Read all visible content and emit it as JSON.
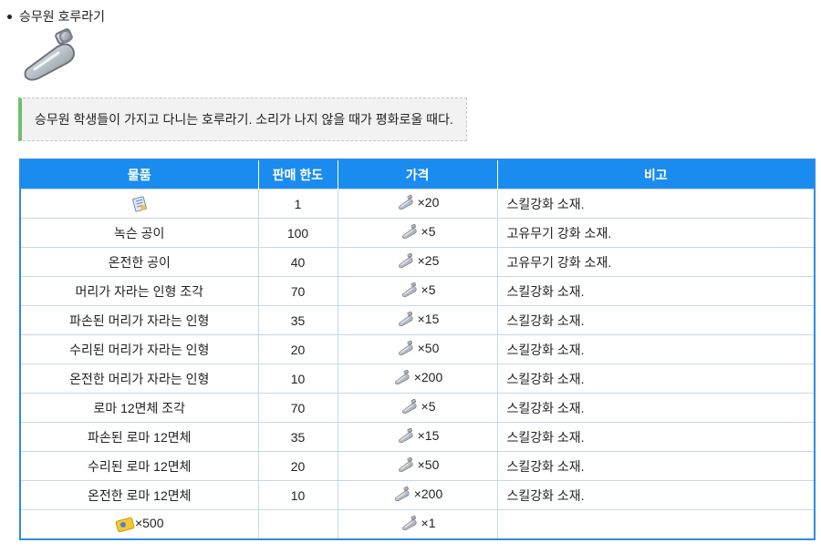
{
  "bullet": {
    "label": "승무원 호루라기"
  },
  "description": "승무원 학생들이 가지고 다니는 호루라기. 소리가 나지 않을 때가 평화로울 때다.",
  "table": {
    "headers": [
      "물품",
      "판매 한도",
      "가격",
      "비고"
    ],
    "rows": [
      {
        "item": "",
        "item_icon": "skill-book-icon",
        "limit": "1",
        "price": "×20",
        "note": "스킬강화 소재."
      },
      {
        "item": "녹슨 공이",
        "limit": "100",
        "price": "×5",
        "note": "고유무기 강화 소재."
      },
      {
        "item": "온전한 공이",
        "limit": "40",
        "price": "×25",
        "note": "고유무기 강화 소재."
      },
      {
        "item": "머리가 자라는 인형 조각",
        "limit": "70",
        "price": "×5",
        "note": "스킬강화 소재."
      },
      {
        "item": "파손된 머리가 자라는 인형",
        "limit": "35",
        "price": "×15",
        "note": "스킬강화 소재."
      },
      {
        "item": "수리된 머리가 자라는 인형",
        "limit": "20",
        "price": "×50",
        "note": "스킬강화 소재."
      },
      {
        "item": "온전한 머리가 자라는 인형",
        "limit": "10",
        "price": "×200",
        "note": "스킬강화 소재."
      },
      {
        "item": "로마 12면체 조각",
        "limit": "70",
        "price": "×5",
        "note": "스킬강화 소재."
      },
      {
        "item": "파손된 로마 12면체",
        "limit": "35",
        "price": "×15",
        "note": "스킬강화 소재."
      },
      {
        "item": "수리된 로마 12면체",
        "limit": "20",
        "price": "×50",
        "note": "스킬강화 소재."
      },
      {
        "item": "온전한 로마 12면체",
        "limit": "10",
        "price": "×200",
        "note": "스킬강화 소재."
      },
      {
        "item": "×500",
        "item_icon": "credit-ticket-icon",
        "limit": "",
        "price": "×1",
        "note": ""
      }
    ]
  }
}
